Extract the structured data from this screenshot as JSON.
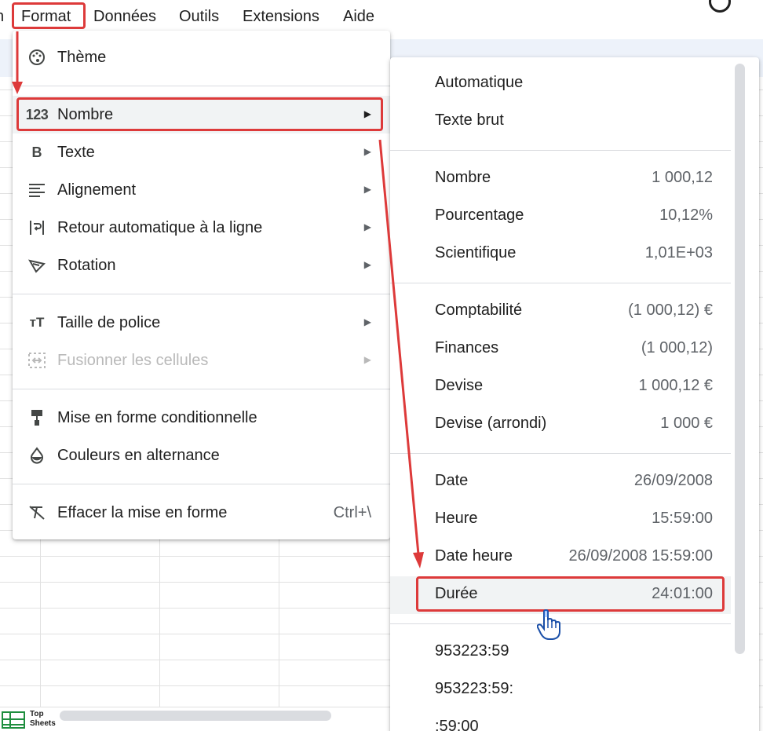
{
  "menubar": {
    "items": [
      "Format",
      "Données",
      "Outils",
      "Extensions",
      "Aide"
    ],
    "partial_left": "n"
  },
  "logo": {
    "line1": "Top",
    "line2": "Sheets"
  },
  "format_menu": {
    "items": [
      {
        "icon": "palette-icon",
        "label": "Thème"
      },
      {
        "icon": "number-123-icon",
        "label": "Nombre"
      },
      {
        "icon": "bold-icon",
        "label": "Texte"
      },
      {
        "icon": "align-left-icon",
        "label": "Alignement"
      },
      {
        "icon": "wrap-icon",
        "label": "Retour automatique à la ligne"
      },
      {
        "icon": "rotation-icon",
        "label": "Rotation"
      },
      {
        "icon": "font-size-icon",
        "label": "Taille de police"
      },
      {
        "icon": "merge-cells-icon",
        "label": "Fusionner les cellules"
      },
      {
        "icon": "paint-roller-icon",
        "label": "Mise en forme conditionnelle"
      },
      {
        "icon": "fill-drop-icon",
        "label": "Couleurs en alternance"
      },
      {
        "icon": "clear-format-icon",
        "label": "Effacer la mise en forme",
        "shortcut": "Ctrl+\\"
      }
    ]
  },
  "number_submenu": {
    "items": [
      {
        "label": "Automatique",
        "example": ""
      },
      {
        "label": "Texte brut",
        "example": ""
      },
      {
        "label": "Nombre",
        "example": "1 000,12"
      },
      {
        "label": "Pourcentage",
        "example": "10,12%"
      },
      {
        "label": "Scientifique",
        "example": "1,01E+03"
      },
      {
        "label": "Comptabilité",
        "example": "(1 000,12) €"
      },
      {
        "label": "Finances",
        "example": "(1 000,12)"
      },
      {
        "label": "Devise",
        "example": "1 000,12 €"
      },
      {
        "label": "Devise (arrondi)",
        "example": "1 000 €"
      },
      {
        "label": "Date",
        "example": "26/09/2008"
      },
      {
        "label": "Heure",
        "example": "15:59:00"
      },
      {
        "label": "Date heure",
        "example": "26/09/2008 15:59:00"
      },
      {
        "label": "Durée",
        "example": "24:01:00"
      },
      {
        "label": "953223:59",
        "example": ""
      },
      {
        "label": "953223:59:",
        "example": ""
      },
      {
        "label": ":59:00",
        "example": ""
      }
    ]
  },
  "colors": {
    "annotation": "#dd3a3a",
    "highlight": "#f1f3f4",
    "toolbar": "#edf2fa"
  }
}
